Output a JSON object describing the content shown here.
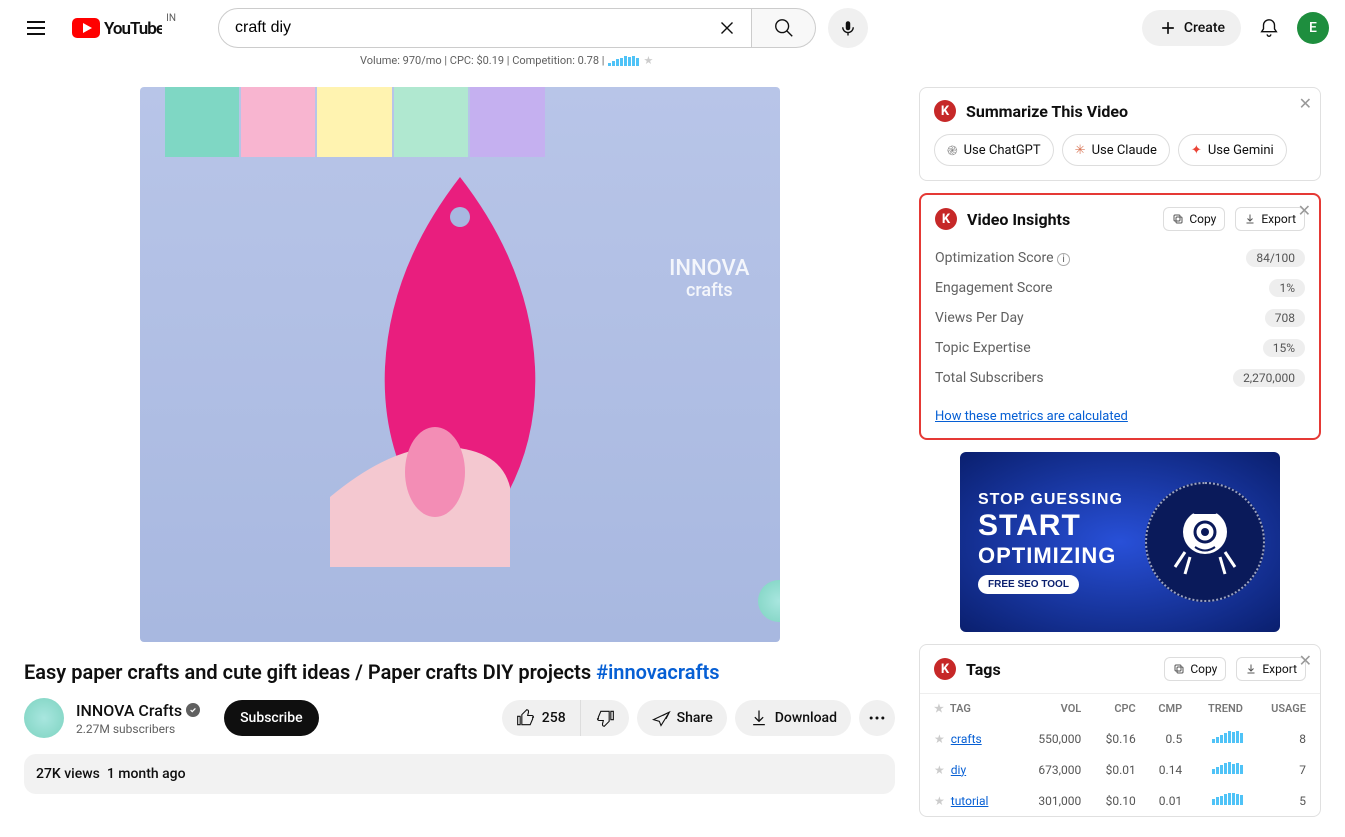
{
  "header": {
    "country": "IN",
    "search_value": "craft diy",
    "create_label": "Create",
    "avatar_initial": "E",
    "seo_line": "Volume: 970/mo | CPC: $0.19 | Competition: 0.78 |"
  },
  "video": {
    "watermark_line1": "INNOVA",
    "watermark_line2": "crafts",
    "title_plain": "Easy paper crafts and cute gift ideas / Paper crafts DIY projects ",
    "title_hashtag": "#innovacrafts",
    "channel_name": "INNOVA Crafts",
    "subscriber_count": "2.27M subscribers",
    "subscribe_label": "Subscribe",
    "like_count": "258",
    "share_label": "Share",
    "download_label": "Download",
    "desc_views": "27K views",
    "desc_age": "1 month ago"
  },
  "summarize": {
    "title": "Summarize This Video",
    "chatgpt": "Use ChatGPT",
    "claude": "Use Claude",
    "gemini": "Use Gemini"
  },
  "insights": {
    "title": "Video Insights",
    "copy": "Copy",
    "export": "Export",
    "metrics": [
      {
        "label": "Optimization Score",
        "value": "84/100",
        "info": true
      },
      {
        "label": "Engagement Score",
        "value": "1%"
      },
      {
        "label": "Views Per Day",
        "value": "708"
      },
      {
        "label": "Topic Expertise",
        "value": "15%"
      },
      {
        "label": "Total Subscribers",
        "value": "2,270,000"
      }
    ],
    "link": "How these metrics are calculated"
  },
  "ad": {
    "line1": "STOP GUESSING",
    "line2": "START",
    "line3": "OPTIMIZING",
    "pill": "FREE SEO TOOL"
  },
  "tags": {
    "title": "Tags",
    "copy": "Copy",
    "export": "Export",
    "headers": [
      "TAG",
      "VOL",
      "CPC",
      "CMP",
      "TREND",
      "USAGE"
    ],
    "rows": [
      {
        "tag": "crafts",
        "vol": "550,000",
        "cpc": "$0.16",
        "cmp": "0.5",
        "usage": "8"
      },
      {
        "tag": "diy",
        "vol": "673,000",
        "cpc": "$0.01",
        "cmp": "0.14",
        "usage": "7"
      },
      {
        "tag": "tutorial",
        "vol": "301,000",
        "cpc": "$0.10",
        "cmp": "0.01",
        "usage": "5"
      }
    ]
  }
}
